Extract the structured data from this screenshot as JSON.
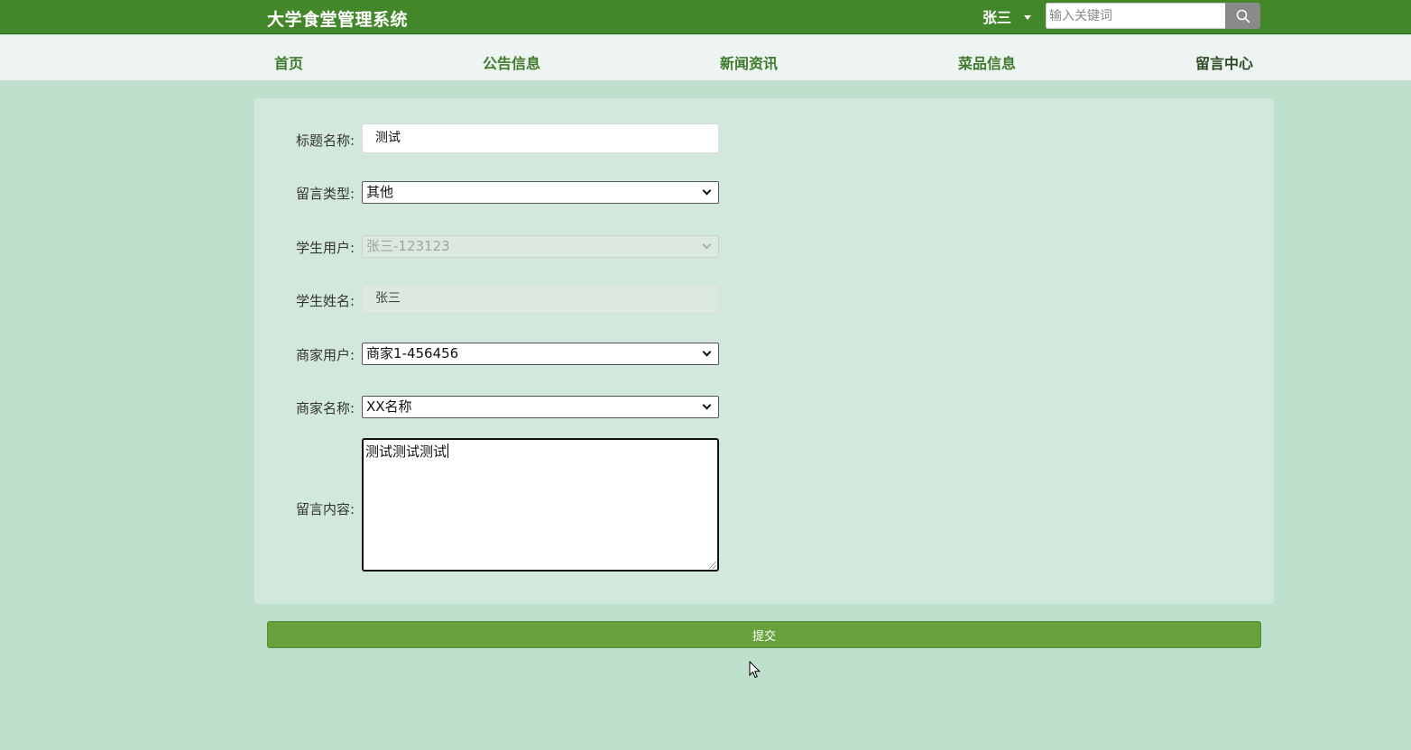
{
  "header": {
    "app_title": "大学食堂管理系统",
    "user_name": "张三",
    "search_placeholder": "输入关键词",
    "search_icon": "search-icon"
  },
  "nav": {
    "items": [
      {
        "label": "首页"
      },
      {
        "label": "公告信息"
      },
      {
        "label": "新闻资讯"
      },
      {
        "label": "菜品信息"
      },
      {
        "label": "留言中心"
      }
    ]
  },
  "form": {
    "title_label": "标题名称:",
    "title_value": "测试",
    "type_label": "留言类型:",
    "type_value": "其他",
    "student_user_label": "学生用户:",
    "student_user_value": "张三-123123",
    "student_name_label": "学生姓名:",
    "student_name_value": "张三",
    "merchant_user_label": "商家用户:",
    "merchant_user_value": "商家1-456456",
    "merchant_name_label": "商家名称:",
    "merchant_name_value": "XX名称",
    "content_label": "留言内容:",
    "content_value": "测试测试测试",
    "submit_label": "提交"
  },
  "colors": {
    "header_bg": "#43872b",
    "page_bg": "#bfe0cc",
    "card_bg": "#d3e8dc",
    "nav_text": "#3f7a2c",
    "submit_bg": "#67a13c"
  }
}
